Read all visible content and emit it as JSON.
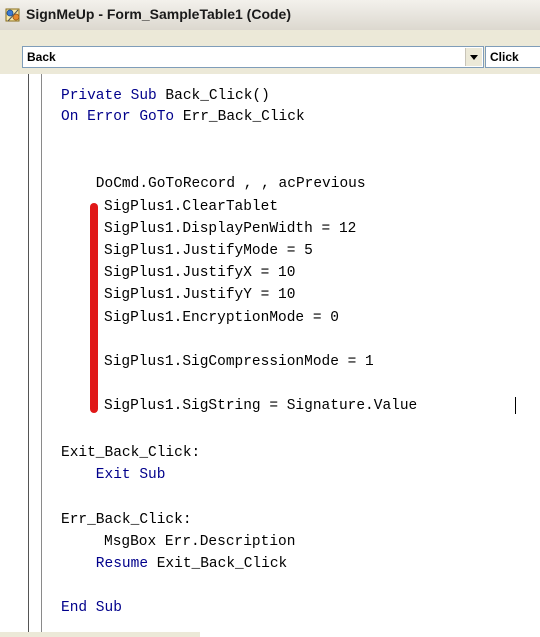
{
  "window": {
    "title": "SignMeUp - Form_SampleTable1 (Code)",
    "icon": "vba-code-icon"
  },
  "toolbar": {
    "object_combo": "Back",
    "procedure_combo": "Click"
  },
  "code": {
    "sub_decl_kw": "Private Sub",
    "sub_decl_rest": " Back_Click()",
    "on_error_kw": "On Error GoTo",
    "on_error_rest": " Err_Back_Click",
    "docmd": "    DoCmd.GoToRecord , , acPrevious",
    "sig_lines": [
      "SigPlus1.ClearTablet",
      "SigPlus1.DisplayPenWidth = 12",
      "SigPlus1.JustifyMode = 5",
      "SigPlus1.JustifyX = 10",
      "SigPlus1.JustifyY = 10",
      "SigPlus1.EncryptionMode = 0",
      "SigPlus1.SigCompressionMode = 1",
      "SigPlus1.SigString = Signature.Value"
    ],
    "exit_label": "Exit_Back_Click:",
    "exit_sub": "    Exit Sub",
    "err_label": "Err_Back_Click:",
    "msgbox_kw": "MsgBox",
    "msgbox_rest": " Err.Description",
    "resume_kw": "    Resume",
    "resume_rest": " Exit_Back_Click",
    "end_sub": "End Sub"
  },
  "colors": {
    "keyword": "#00008b",
    "marker": "#e01818"
  }
}
